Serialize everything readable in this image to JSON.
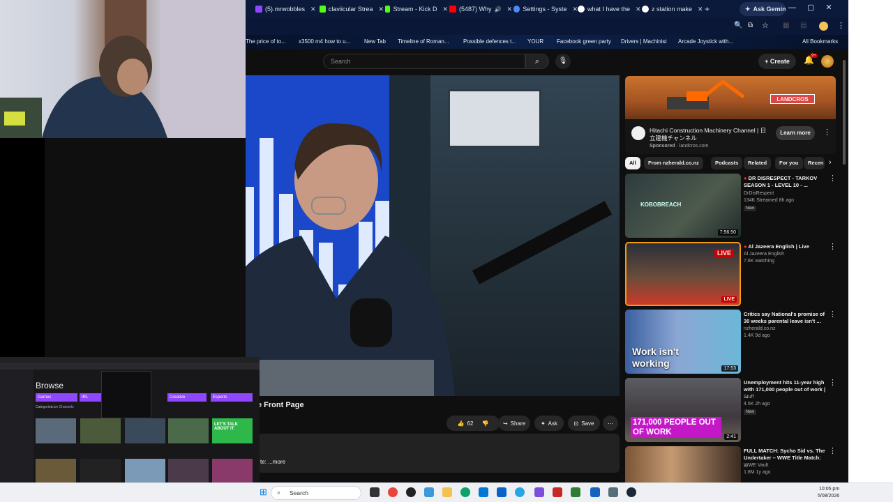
{
  "browser": {
    "tabs": [
      {
        "label": "(5).mrwobbles",
        "color": "#9147ff"
      },
      {
        "label": "claviicular Strea",
        "color": "#53fc18"
      },
      {
        "label": "Stream - Kick D",
        "color": "#53fc18"
      },
      {
        "label": "(5487) Why",
        "color": "#ff0000"
      },
      {
        "label": "Settings - Syste",
        "color": "#4c8bf5"
      },
      {
        "label": "what I have the",
        "color": "#ffffff"
      },
      {
        "label": "z station make",
        "color": "#ffffff"
      }
    ],
    "new_tab": "+",
    "ask_gemini": "Ask Gemini",
    "bookmarks": [
      "The price of to...",
      "x3500 m4 how to u...",
      "New Tab",
      "Timeline of Roman...",
      "Possible defences t...",
      "YOUR",
      "Facebook green party",
      "Drivers | Machinist",
      "Arcade Joystick with...",
      "All Bookmarks"
    ]
  },
  "youtube": {
    "search_placeholder": "Search",
    "create_label": "Create",
    "notif_count": "9+",
    "video_title": "e Front Page",
    "likes": "62",
    "share": "Share",
    "ask": "Ask",
    "save": "Save",
    "desc_more": "te: ...more",
    "ad": {
      "banner": "LANDCROS",
      "title": "Hitachi Construction Machinery Channel | 日立建機チャンネル",
      "sponsored": "Sponsored",
      "domain": "landcros.com",
      "cta": "Learn more"
    },
    "chips": [
      "All",
      "From nzherald.co.nz",
      "Podcasts",
      "Related",
      "For you",
      "Recen"
    ],
    "recs": [
      {
        "title": "DR DISRESPECT - TARKOV SEASON 1 - LEVEL 10 - ...",
        "channel": "DrDisRespect",
        "stats": "134K  Streamed 8h ago",
        "badge": "New",
        "duration": "7:56:50",
        "thumb_text": "KOBOBREACH"
      },
      {
        "title": "Al Jazeera English | Live",
        "channel": "Al Jazeera English",
        "stats": "7.6K watching",
        "badge": "",
        "duration": "LIVE",
        "thumb_text": "LIVE"
      },
      {
        "title": "Critics say National's promise of 30 weeks parental leave isn't ...",
        "channel": "nzherald.co.nz",
        "stats": "1.4K  9d ago",
        "badge": "",
        "duration": "17:53",
        "thumb_text": "Work isn't working"
      },
      {
        "title": "Unemployment hits 11-year high with 171,000 people out of work | ...",
        "channel": "Stuff",
        "stats": "4.5K  2h ago",
        "badge": "New",
        "duration": "2:41",
        "thumb_text": "171,000 PEOPLE OUT OF WORK"
      },
      {
        "title": "FULL MATCH: Sycho Sid vs. The Undertaker – WWE Title Match: ...",
        "channel": "WWE Vault",
        "stats": "1.8M  1y ago",
        "badge": "",
        "duration": "",
        "thumb_text": ""
      }
    ]
  },
  "twitch": {
    "browse": "Browse",
    "categories_tab": "Categories",
    "live_tab": "Live Channels",
    "cats": [
      "Games",
      "IRL",
      "Creative",
      "Esports"
    ],
    "promo": "LET'S TALK ABOUT IT."
  },
  "taskbar": {
    "search": "Search",
    "time": "10:05 pm",
    "date": "5/08/2026"
  },
  "colors": {
    "yt_bg": "#0f0f0f",
    "live_red": "#cc0000",
    "twitch_purple": "#9147ff"
  }
}
